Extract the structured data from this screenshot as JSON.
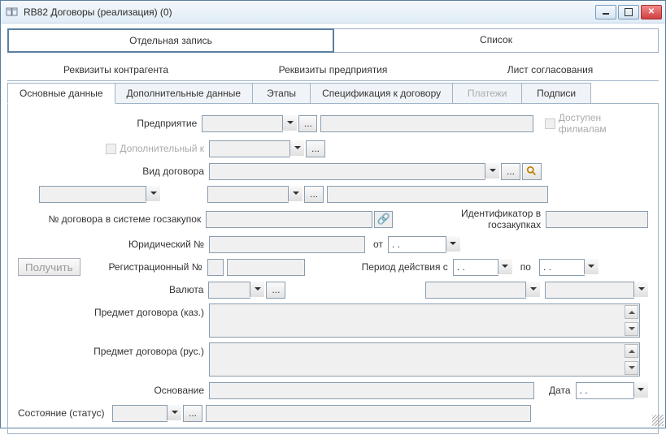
{
  "window": {
    "title": "RB82 Договоры (реализация) (0)"
  },
  "mainTabs": {
    "single": "Отдельная запись",
    "list": "Список"
  },
  "subTabs1": {
    "contragent": "Реквизиты контрагента",
    "enterprise": "Реквизиты предприятия",
    "approval": "Лист согласования"
  },
  "subTabs2": {
    "main": "Основные данные",
    "additional": "Дополнительные данные",
    "stages": "Этапы",
    "spec": "Спецификация к договору",
    "payments": "Платежи",
    "signatures": "Подписи"
  },
  "labels": {
    "enterprise": "Предприятие",
    "additionalTo": "Дополнительный к",
    "contractType": "Вид договора",
    "govProcNumber": "№ договора в системе госзакупок",
    "govProcId": "Идентификатор в госзакупках",
    "legalNumber": "Юридический №",
    "from": "от",
    "regNumber": "Регистрационный №",
    "period": "Период действия с",
    "to": "по",
    "currency": "Валюта",
    "subjectKz": "Предмет договора (каз.)",
    "subjectRu": "Предмет договора (рус.)",
    "basis": "Основание",
    "date": "Дата",
    "status": "Состояние (статус)",
    "availableBranches": "Доступен филиалам",
    "get": "Получить"
  },
  "values": {
    "datePlaceholder": "  .  .",
    "ellipsis": "..."
  }
}
